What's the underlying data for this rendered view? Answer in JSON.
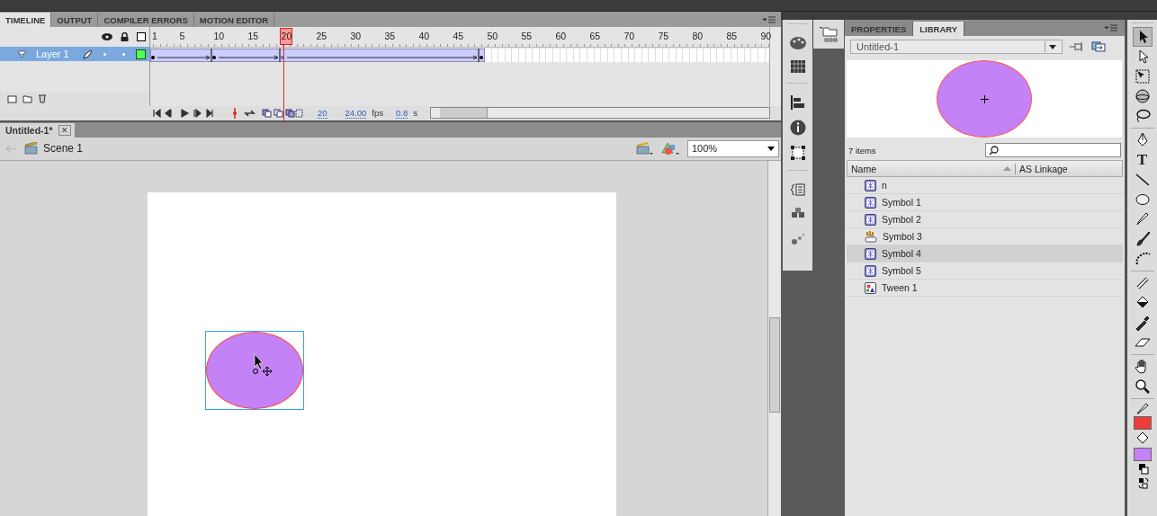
{
  "timeline_panel": {
    "tabs": [
      {
        "label": "TIMELINE",
        "selected": true
      },
      {
        "label": "OUTPUT",
        "selected": false
      },
      {
        "label": "COMPILER ERRORS",
        "selected": false
      },
      {
        "label": "MOTION EDITOR",
        "selected": false
      }
    ],
    "frame_numbers": [
      "1",
      "5",
      "10",
      "15",
      "20",
      "25",
      "30",
      "35",
      "40",
      "45",
      "50",
      "55",
      "60",
      "65",
      "70",
      "75",
      "80",
      "85",
      "90"
    ],
    "layers": [
      {
        "name": "Layer 1",
        "selected": true
      }
    ],
    "status": {
      "current_frame": "20",
      "frame_rate": "24.00",
      "fps_unit": "fps",
      "elapsed": "0.8",
      "time_unit": "s"
    }
  },
  "document_tab": {
    "title": "Untitled-1*",
    "close": "✕"
  },
  "edit_bar": {
    "scene": "Scene 1",
    "zoom": "100%"
  },
  "library": {
    "tabs": [
      {
        "label": "PROPERTIES",
        "selected": false
      },
      {
        "label": "LIBRARY",
        "selected": true
      }
    ],
    "document": "Untitled-1",
    "item_count": "7 items",
    "columns": [
      "Name",
      "AS Linkage"
    ],
    "items": [
      {
        "name": "n",
        "kind": "movieclip",
        "selected": false
      },
      {
        "name": "Symbol 1",
        "kind": "movieclip",
        "selected": false
      },
      {
        "name": "Symbol 2",
        "kind": "movieclip",
        "selected": false
      },
      {
        "name": "Symbol 3",
        "kind": "button",
        "selected": false
      },
      {
        "name": "Symbol 4",
        "kind": "movieclip",
        "selected": true
      },
      {
        "name": "Symbol 5",
        "kind": "movieclip",
        "selected": false
      },
      {
        "name": "Tween 1",
        "kind": "graphic",
        "selected": false
      }
    ]
  },
  "tools": {
    "text_tool": "T",
    "swatches": [
      {
        "kind": "stroke",
        "color": "#ee3b3b"
      },
      {
        "kind": "fill",
        "color": "#c382f5"
      }
    ]
  }
}
